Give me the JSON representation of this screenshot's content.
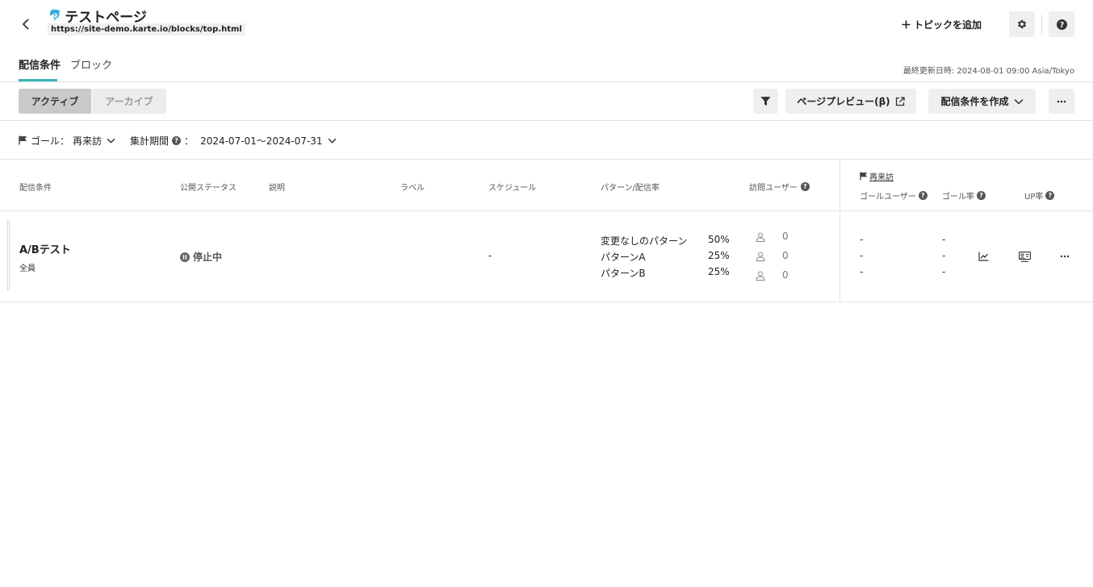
{
  "header": {
    "emoji": "🐬",
    "title": "テストページ",
    "url": "https://site-demo.karte.io/blocks/top.html",
    "add_topic_label": "トピックを追加"
  },
  "tabs": {
    "conditions": "配信条件",
    "block": "ブロック",
    "last_update": "最終更新日時: 2024-08-01 09:00 Asia/Tokyo"
  },
  "toolbar": {
    "active_label": "アクティブ",
    "archive_label": "アーカイブ",
    "preview_label": "ページプレビュー(β)",
    "create_label": "配信条件を作成"
  },
  "goal_bar": {
    "goal_label": "ゴール：",
    "goal_value": "再来訪",
    "period_label": "集計期間",
    "period_sep": "：",
    "period_value": "2024-07-01〜2024-07-31"
  },
  "table": {
    "headers": {
      "condition": "配信条件",
      "status": "公開ステータス",
      "description": "説明",
      "label": "ラベル",
      "schedule": "スケジュール",
      "pattern": "パターン/配信率",
      "visit_users": "訪問ユーザー",
      "goal_name": "再来訪",
      "goal_users": "ゴールユーザー",
      "goal_rate": "ゴール率",
      "up_rate": "UP率"
    },
    "rows": [
      {
        "name": "A/Bテスト",
        "target": "全員",
        "status": "停止中",
        "schedule": "-",
        "patterns": [
          {
            "name": "変更なしのパターン",
            "rate": "50%",
            "visits": "0",
            "goal_users": "-",
            "goal_rate": "-"
          },
          {
            "name": "パターンA",
            "rate": "25%",
            "visits": "0",
            "goal_users": "-",
            "goal_rate": "-"
          },
          {
            "name": "パターンB",
            "rate": "25%",
            "visits": "0",
            "goal_users": "-",
            "goal_rate": "-"
          }
        ]
      }
    ]
  },
  "colors": {
    "accent": "#37b3b8",
    "button_bg": "#efefef",
    "segment_active_bg": "#c9c9c9"
  },
  "icons": [
    "chevron-left-icon",
    "plus-icon",
    "gear-icon",
    "help-icon",
    "filter-icon",
    "external-link-icon",
    "chevron-down-icon",
    "more-icon",
    "flag-icon",
    "pause-icon",
    "user-icon",
    "chart-icon",
    "compare-icon"
  ]
}
